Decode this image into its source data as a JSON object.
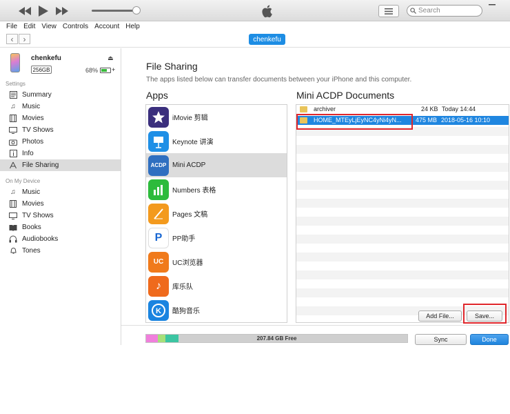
{
  "topbar": {
    "rewind_icon": "rewind-icon",
    "play_icon": "play-icon",
    "forward_icon": "fast-forward-icon",
    "volume_level": 0.85,
    "search_placeholder": "Search"
  },
  "menu": [
    "File",
    "Edit",
    "View",
    "Controls",
    "Account",
    "Help"
  ],
  "device_pill": "chenkefu",
  "device": {
    "name": "chenkefu",
    "capacity": "256GB",
    "battery_pct": "68%",
    "battery_level": 0.68
  },
  "sidebar": {
    "settings_header": "Settings",
    "settings_items": [
      {
        "label": "Summary",
        "icon": "summary-icon"
      },
      {
        "label": "Music",
        "icon": "music-note-icon"
      },
      {
        "label": "Movies",
        "icon": "film-icon"
      },
      {
        "label": "TV Shows",
        "icon": "tv-icon"
      },
      {
        "label": "Photos",
        "icon": "camera-icon"
      },
      {
        "label": "Info",
        "icon": "info-icon"
      },
      {
        "label": "File Sharing",
        "icon": "app-store-icon"
      }
    ],
    "ondevice_header": "On My Device",
    "device_items": [
      {
        "label": "Music",
        "icon": "music-note-icon"
      },
      {
        "label": "Movies",
        "icon": "film-icon"
      },
      {
        "label": "TV Shows",
        "icon": "tv-icon"
      },
      {
        "label": "Books",
        "icon": "book-icon"
      },
      {
        "label": "Audiobooks",
        "icon": "audiobook-icon"
      },
      {
        "label": "Tones",
        "icon": "bell-icon"
      }
    ]
  },
  "main": {
    "title": "File Sharing",
    "subtitle": "The apps listed below can transfer documents between your iPhone and this computer.",
    "apps_header": "Apps",
    "docs_header": "Mini ACDP Documents"
  },
  "apps": [
    {
      "name": "iMovie 剪辑",
      "icon_text": "★",
      "color": "#3b2f7d"
    },
    {
      "name": "Keynote 讲演",
      "icon_text": "▬",
      "color": "#1f8fe6"
    },
    {
      "name": "Mini ACDP",
      "icon_text": "ACDP",
      "color": "#2f6fc0"
    },
    {
      "name": "Numbers 表格",
      "icon_text": "▮▮▮",
      "color": "#2dbb3c"
    },
    {
      "name": "Pages 文稿",
      "icon_text": "╱",
      "color": "#f39a1e"
    },
    {
      "name": "PP助手",
      "icon_text": "P",
      "color": "#ffffff"
    },
    {
      "name": "UC浏览器",
      "icon_text": "UC",
      "color": "#f07a1b"
    },
    {
      "name": "库乐队",
      "icon_text": "♪",
      "color": "#ef6a1c"
    },
    {
      "name": "酷狗音乐",
      "icon_text": "K",
      "color": "#1a84e0"
    }
  ],
  "documents": [
    {
      "name": "archiver",
      "size": "24 KB",
      "date": "Today 14:44"
    },
    {
      "name": "HOME_MTEyLjEyNC4yNi4yN...",
      "size": "475 MB",
      "date": "2018-05-16 10:10"
    }
  ],
  "buttons": {
    "add_file": "Add File...",
    "save": "Save...",
    "sync": "Sync",
    "done": "Done"
  },
  "storage": {
    "free_label": "207.84 GB Free",
    "segments": [
      {
        "color": "#f07fdc",
        "fraction": 0.045
      },
      {
        "color": "#a6e07a",
        "fraction": 0.03
      },
      {
        "color": "#3cc5a2",
        "fraction": 0.05
      }
    ]
  }
}
